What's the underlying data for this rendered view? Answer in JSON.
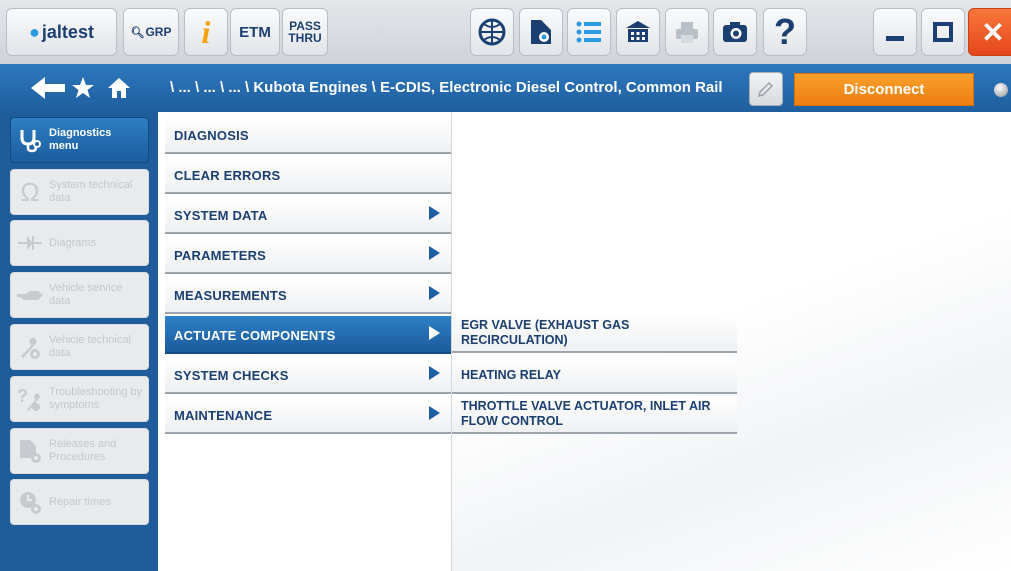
{
  "toolbar": {
    "logo_text": "jaltest",
    "grp_label": "GRP",
    "info_label": "i",
    "etm_label": "ETM",
    "pass_label_1": "PASS",
    "pass_label_2": "THRU",
    "help_label": "?",
    "close_label": "✕"
  },
  "navbar": {
    "breadcrumb": "\\ ... \\ ... \\ ... \\ Kubota Engines \\ E-CDIS, Electronic Diesel Control, Common Rail",
    "disconnect_label": "Disconnect"
  },
  "sidebar": {
    "items": [
      {
        "label": "Diagnostics menu",
        "icon": "stethoscope-icon",
        "active": true
      },
      {
        "label": "System technical data",
        "icon": "omega-icon",
        "active": false
      },
      {
        "label": "Diagrams",
        "icon": "diode-icon",
        "active": false
      },
      {
        "label": "Vehicle service data",
        "icon": "oil-can-icon",
        "active": false
      },
      {
        "label": "Vehicle technical data",
        "icon": "wrench-gear-icon",
        "active": false
      },
      {
        "label": "Troubleshooting by symptoms",
        "icon": "question-wrench-icon",
        "active": false
      },
      {
        "label": "Releases and Procedures",
        "icon": "document-gear-icon",
        "active": false
      },
      {
        "label": "Repair times",
        "icon": "clock-gear-icon",
        "active": false
      }
    ]
  },
  "menu": {
    "items": [
      {
        "label": "DIAGNOSIS",
        "has_submenu": false
      },
      {
        "label": "CLEAR ERRORS",
        "has_submenu": false
      },
      {
        "label": "SYSTEM DATA",
        "has_submenu": true
      },
      {
        "label": "PARAMETERS",
        "has_submenu": true
      },
      {
        "label": "MEASUREMENTS",
        "has_submenu": true
      },
      {
        "label": "ACTUATE COMPONENTS",
        "has_submenu": true,
        "active": true
      },
      {
        "label": "SYSTEM CHECKS",
        "has_submenu": true
      },
      {
        "label": "MAINTENANCE",
        "has_submenu": true
      }
    ]
  },
  "submenu": {
    "items": [
      {
        "label": "EGR VALVE (EXHAUST GAS RECIRCULATION)"
      },
      {
        "label": "HEATING RELAY"
      },
      {
        "label": "THROTTLE VALVE ACTUATOR, INLET AIR FLOW CONTROL"
      }
    ]
  },
  "colors": {
    "brand_blue": "#1c3f71",
    "nav_blue": "#2d77bd",
    "disconnect_orange": "#f39020",
    "close_red": "#e6461d"
  }
}
